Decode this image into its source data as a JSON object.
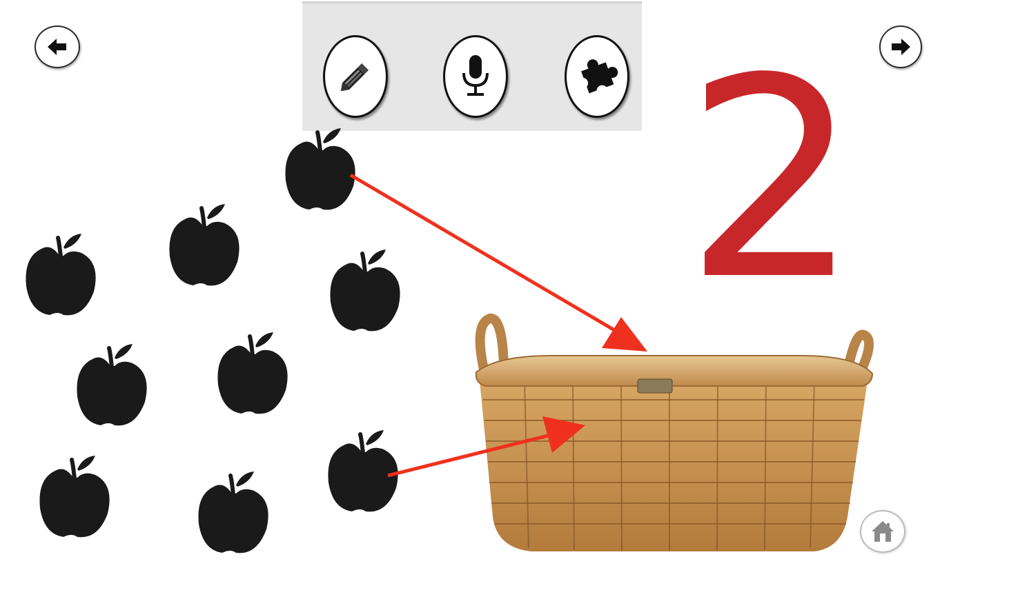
{
  "lesson": {
    "number": "2"
  },
  "navigation": {
    "back_icon": "arrow-left-icon",
    "next_icon": "arrow-right-icon",
    "home_icon": "home-icon"
  },
  "toolbar": {
    "tools": [
      {
        "name": "pencil-icon"
      },
      {
        "name": "microphone-icon"
      },
      {
        "name": "puzzle-icon"
      }
    ]
  },
  "scene": {
    "apples_count": 9,
    "arrows_count": 2,
    "colors": {
      "number": "#c8272a",
      "arrow": "#f0301e",
      "apple": "#1a1a1a"
    }
  }
}
